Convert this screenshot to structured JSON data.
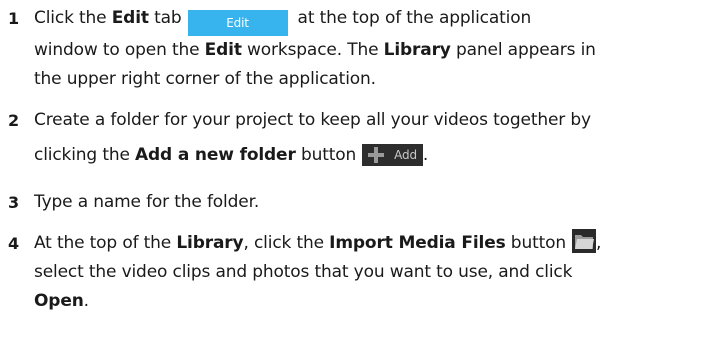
{
  "steps": [
    {
      "number": "1",
      "lines": [
        [
          {
            "t": "Click the "
          },
          {
            "t": "Edit",
            "b": true
          },
          {
            "t": " tab"
          },
          {
            "widget": "edit_tab"
          },
          {
            "t": "at the top of the application"
          }
        ],
        [
          {
            "t": "window to open the "
          },
          {
            "t": "Edit",
            "b": true
          },
          {
            "t": " workspace. The "
          },
          {
            "t": "Library",
            "b": true
          },
          {
            "t": " panel appears in"
          }
        ],
        [
          {
            "t": "the upper right corner of the application."
          }
        ]
      ]
    },
    {
      "number": "2",
      "lines": [
        [
          {
            "t": "Create a folder for your project to keep all your videos together by"
          }
        ],
        [
          {
            "t": "clicking the "
          },
          {
            "t": "Add a new folder",
            "b": true
          },
          {
            "t": " button"
          },
          {
            "widget": "add_button"
          },
          {
            "t": "."
          }
        ]
      ]
    },
    {
      "number": "3",
      "lines": [
        [
          {
            "t": "Type a name for the folder."
          }
        ]
      ]
    },
    {
      "number": "4",
      "lines": [
        [
          {
            "t": "At the top of the "
          },
          {
            "t": "Library",
            "b": true
          },
          {
            "t": ", click the "
          },
          {
            "t": "Import Media Files",
            "b": true
          },
          {
            "t": " button"
          },
          {
            "widget": "import_button"
          },
          {
            "t": ","
          }
        ],
        [
          {
            "t": "select the video clips and photos that you want to use, and click"
          }
        ],
        [
          {
            "t": "Open",
            "b": true
          },
          {
            "t": "."
          }
        ]
      ]
    }
  ],
  "widgets": {
    "edit_tab": {
      "label": "Edit",
      "color": "#37b4ee"
    },
    "add_button": {
      "label": "Add",
      "icon": "plus-icon",
      "background": "#2d2d2d"
    },
    "import_button": {
      "icon": "folder-icon",
      "background": "#2a2a2a"
    }
  }
}
